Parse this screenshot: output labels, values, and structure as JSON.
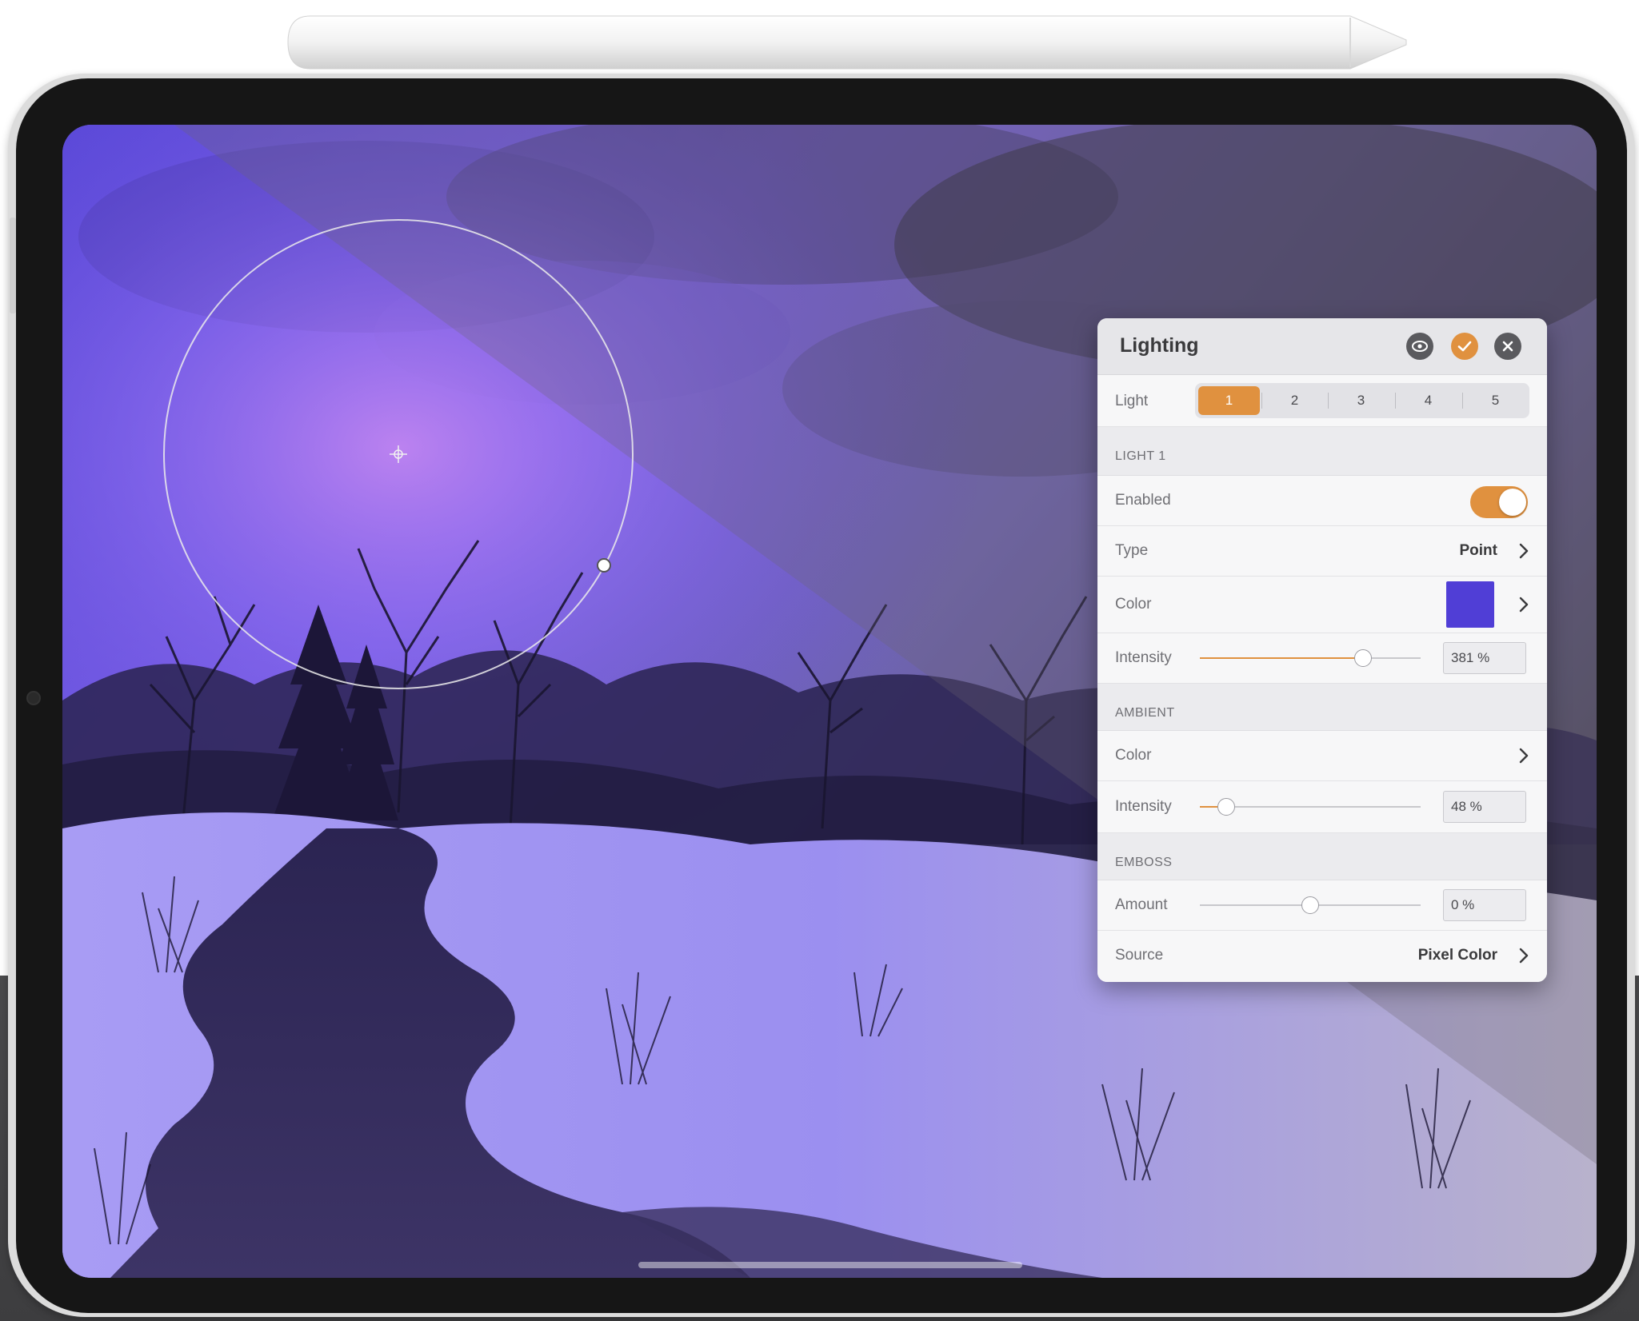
{
  "panel": {
    "title": "Lighting",
    "light_row": {
      "label": "Light",
      "options": [
        "1",
        "2",
        "3",
        "4",
        "5"
      ],
      "selected": "1"
    },
    "light_section": {
      "heading": "LIGHT 1",
      "enabled_label": "Enabled",
      "enabled": true,
      "type_label": "Type",
      "type_value": "Point",
      "color_label": "Color",
      "color_value": "#503ed6",
      "intensity_label": "Intensity",
      "intensity_value": "381 %",
      "intensity_slider": 0.74
    },
    "ambient_section": {
      "heading": "AMBIENT",
      "color_label": "Color",
      "intensity_label": "Intensity",
      "intensity_value": "48 %",
      "intensity_slider": 0.12
    },
    "emboss_section": {
      "heading": "EMBOSS",
      "amount_label": "Amount",
      "amount_value": "0 %",
      "amount_slider": 0.5,
      "source_label": "Source",
      "source_value": "Pixel Color"
    }
  },
  "colors": {
    "accent": "#e0913f",
    "light_color": "#503ed6"
  },
  "icons": {
    "visibility": "eye-icon",
    "apply": "checkmark-icon",
    "cancel": "close-icon",
    "light_position": "crosshair-icon"
  }
}
